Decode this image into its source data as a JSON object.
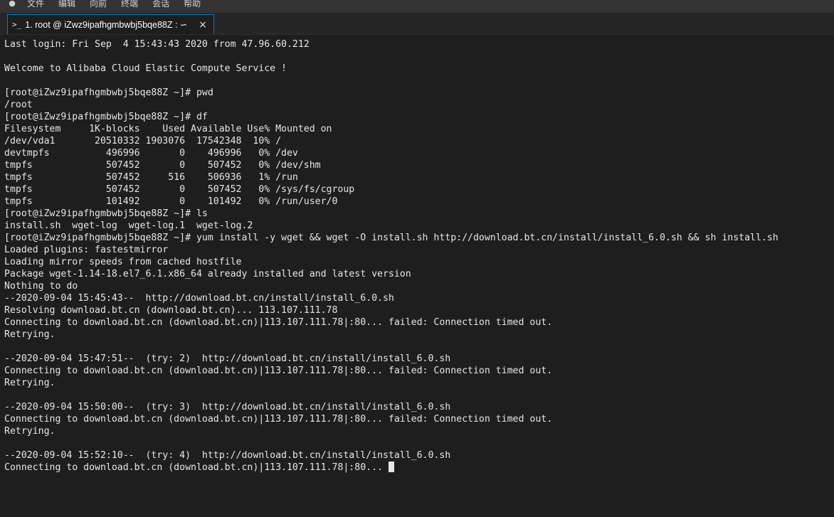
{
  "menubar": {
    "app_icon": "tux-icon",
    "items": [
      "文件",
      "编辑",
      "向前",
      "终端",
      "会话",
      "帮助"
    ]
  },
  "tab": {
    "icon": "terminal-prompt-icon",
    "prompt_glyph": ">_",
    "title": "1. root @ iZwz9ipafhgmbwbj5bqe88Z : ∽",
    "close_glyph": "×"
  },
  "terminal": {
    "lines": [
      "Last login: Fri Sep  4 15:43:43 2020 from 47.96.60.212",
      "",
      "Welcome to Alibaba Cloud Elastic Compute Service !",
      "",
      "[root@iZwz9ipafhgmbwbj5bqe88Z ~]# pwd",
      "/root",
      "[root@iZwz9ipafhgmbwbj5bqe88Z ~]# df",
      "Filesystem     1K-blocks    Used Available Use% Mounted on",
      "/dev/vda1       20510332 1903076  17542348  10% /",
      "devtmpfs          496996       0    496996   0% /dev",
      "tmpfs             507452       0    507452   0% /dev/shm",
      "tmpfs             507452     516    506936   1% /run",
      "tmpfs             507452       0    507452   0% /sys/fs/cgroup",
      "tmpfs             101492       0    101492   0% /run/user/0",
      "[root@iZwz9ipafhgmbwbj5bqe88Z ~]# ls",
      "install.sh  wget-log  wget-log.1  wget-log.2",
      "[root@iZwz9ipafhgmbwbj5bqe88Z ~]# yum install -y wget && wget -O install.sh http://download.bt.cn/install/install_6.0.sh && sh install.sh",
      "Loaded plugins: fastestmirror",
      "Loading mirror speeds from cached hostfile",
      "Package wget-1.14-18.el7_6.1.x86_64 already installed and latest version",
      "Nothing to do",
      "--2020-09-04 15:45:43--  http://download.bt.cn/install/install_6.0.sh",
      "Resolving download.bt.cn (download.bt.cn)... 113.107.111.78",
      "Connecting to download.bt.cn (download.bt.cn)|113.107.111.78|:80... failed: Connection timed out.",
      "Retrying.",
      "",
      "--2020-09-04 15:47:51--  (try: 2)  http://download.bt.cn/install/install_6.0.sh",
      "Connecting to download.bt.cn (download.bt.cn)|113.107.111.78|:80... failed: Connection timed out.",
      "Retrying.",
      "",
      "--2020-09-04 15:50:00--  (try: 3)  http://download.bt.cn/install/install_6.0.sh",
      "Connecting to download.bt.cn (download.bt.cn)|113.107.111.78|:80... failed: Connection timed out.",
      "Retrying.",
      "",
      "--2020-09-04 15:52:10--  (try: 4)  http://download.bt.cn/install/install_6.0.sh"
    ],
    "active_line": "Connecting to download.bt.cn (download.bt.cn)|113.107.111.78|:80..."
  },
  "colors": {
    "background": "#1e1e1e",
    "text": "#e6e6e6",
    "tab_border_accent": "#007acc",
    "menubar": "#333333"
  }
}
